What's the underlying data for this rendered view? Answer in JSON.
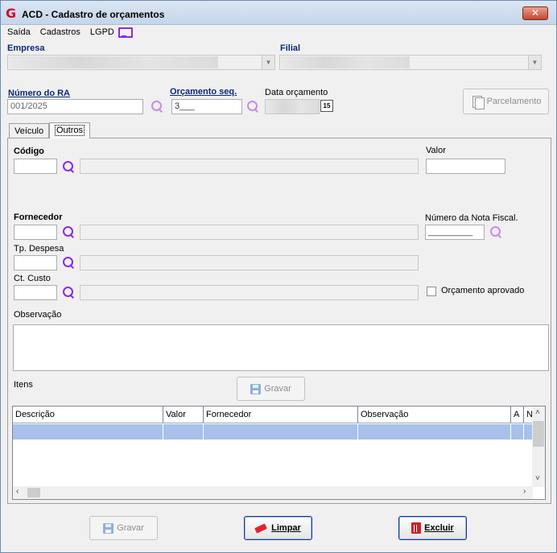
{
  "window": {
    "title": "ACD - Cadastro de orçamentos",
    "close_label": "✕"
  },
  "menu": {
    "items": [
      "Saída",
      "Cadastros",
      "LGPD"
    ],
    "icon": "monitor-icon"
  },
  "header": {
    "empresa_label": "Empresa",
    "filial_label": "Filial",
    "numero_ra_label": "Número do RA",
    "numero_ra_value": "001/2025",
    "orcamento_seq_label": "Orçamento seq.",
    "orcamento_seq_value": "3___",
    "data_orcamento_label": "Data orçamento",
    "calendar_label": "15",
    "parcelamento_label": "Parcelamento"
  },
  "tabs": [
    {
      "label": "Veículo",
      "active": false
    },
    {
      "label": "Outros",
      "active": true
    }
  ],
  "form": {
    "codigo_label": "Código",
    "valor_label": "Valor",
    "fornecedor_label": "Fornecedor",
    "nota_fiscal_label": "Número da Nota Fiscal.",
    "nota_fiscal_value": "_________",
    "tp_despesa_label": "Tp. Despesa",
    "ct_custo_label": "Ct. Custo",
    "orcamento_aprovado_label": "Orçamento aprovado",
    "observacao_label": "Observação",
    "itens_label": "Itens",
    "gravar_itens_label": "Gravar"
  },
  "grid": {
    "columns": [
      "Descrição",
      "Valor",
      "Fornecedor",
      "Observação",
      "A",
      "N"
    ]
  },
  "footer": {
    "gravar_label": "Gravar",
    "limpar_label": "Limpar",
    "excluir_label": "Excluir"
  },
  "colors": {
    "accent": "#8a2be2",
    "label_navy": "#0a2a7a",
    "selected_row": "#a8c0ea",
    "danger": "#d21f26"
  }
}
